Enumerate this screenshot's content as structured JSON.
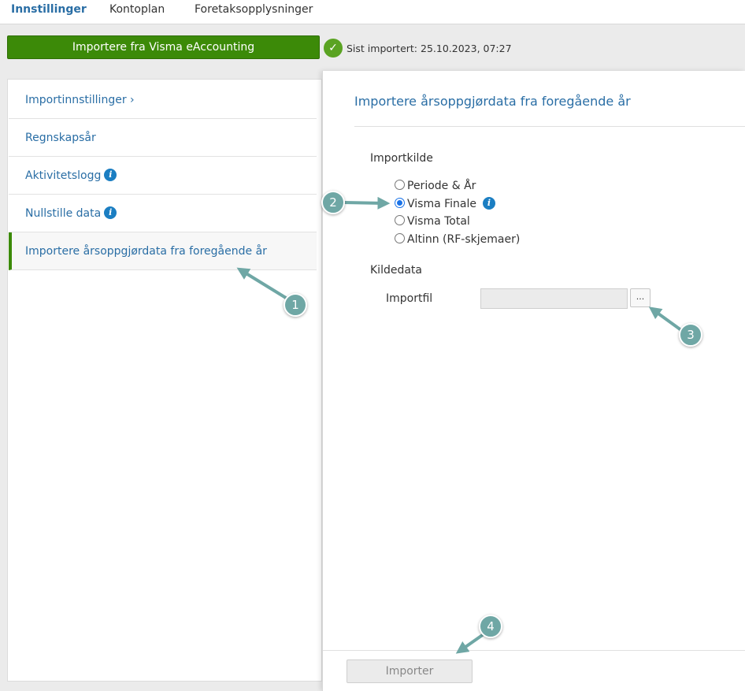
{
  "topnav": {
    "tabs": [
      {
        "label": "Innstillinger",
        "active": true
      },
      {
        "label": "Kontoplan",
        "active": false
      },
      {
        "label": "Foretaksopplysninger",
        "active": false
      }
    ]
  },
  "toolbar": {
    "import_button_label": "Importere fra Visma eAccounting",
    "last_import_label": "Sist importert:",
    "last_import_value": "25.10.2023, 07:27"
  },
  "sidebar": {
    "items": [
      {
        "label": "Importinnstillinger ›",
        "info": false,
        "active": false
      },
      {
        "label": "Regnskapsår",
        "info": false,
        "active": false
      },
      {
        "label": "Aktivitetslogg",
        "info": true,
        "active": false
      },
      {
        "label": "Nullstille data",
        "info": true,
        "active": false
      },
      {
        "label": "Importere årsoppgjørdata fra foregående år",
        "info": false,
        "active": true
      }
    ]
  },
  "main": {
    "title": "Importere årsoppgjørdata fra foregående år",
    "import_source_label": "Importkilde",
    "sources": [
      {
        "label": "Periode & År",
        "checked": false,
        "info": false
      },
      {
        "label": "Visma Finale",
        "checked": true,
        "info": true
      },
      {
        "label": "Visma Total",
        "checked": false,
        "info": false
      },
      {
        "label": "Altinn (RF-skjemaer)",
        "checked": false,
        "info": false
      }
    ],
    "source_data_label": "Kildedata",
    "import_file_label": "Importfil",
    "import_file_value": "",
    "browse_label": "...",
    "submit_label": "Importer"
  },
  "annotations": [
    "1",
    "2",
    "3",
    "4"
  ],
  "colors": {
    "accent": "#2a6ea5",
    "primary_button": "#3c8a08",
    "success": "#5aa322",
    "info": "#1b7ec2",
    "annotation": "#6fa7a5"
  }
}
